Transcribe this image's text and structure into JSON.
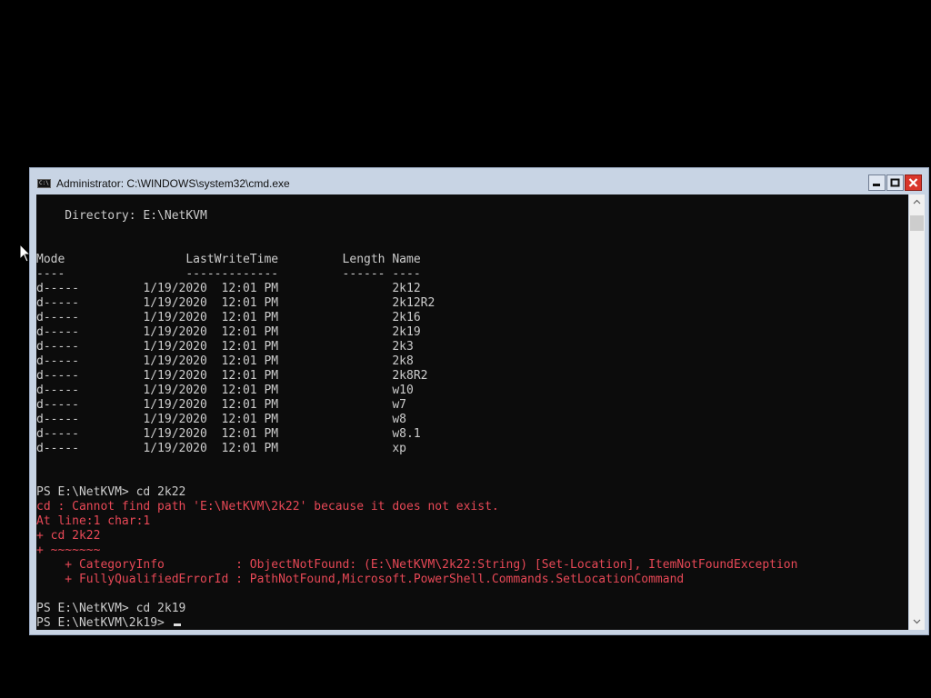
{
  "window": {
    "title": "Administrator: C:\\WINDOWS\\system32\\cmd.exe",
    "icon_text": "C:\\",
    "app_icon": "cmd-icon",
    "controls": [
      "minimize-icon",
      "maximize-icon",
      "close-icon"
    ]
  },
  "colors": {
    "console_bg": "#0c0c0c",
    "console_text": "#cccccc",
    "error_text": "#e74856",
    "titlebar_bg": "#c8d4e4",
    "close_button": "#d9362b"
  },
  "console": {
    "lines": [
      {
        "text": "",
        "type": "normal"
      },
      {
        "text": "    Directory: E:\\NetKVM",
        "type": "normal"
      },
      {
        "text": "",
        "type": "normal"
      },
      {
        "text": "",
        "type": "normal"
      },
      {
        "text": "Mode                 LastWriteTime         Length Name",
        "type": "normal"
      },
      {
        "text": "----                 -------------         ------ ----",
        "type": "normal"
      },
      {
        "text": "d-----         1/19/2020  12:01 PM                2k12",
        "type": "normal"
      },
      {
        "text": "d-----         1/19/2020  12:01 PM                2k12R2",
        "type": "normal"
      },
      {
        "text": "d-----         1/19/2020  12:01 PM                2k16",
        "type": "normal"
      },
      {
        "text": "d-----         1/19/2020  12:01 PM                2k19",
        "type": "normal"
      },
      {
        "text": "d-----         1/19/2020  12:01 PM                2k3",
        "type": "normal"
      },
      {
        "text": "d-----         1/19/2020  12:01 PM                2k8",
        "type": "normal"
      },
      {
        "text": "d-----         1/19/2020  12:01 PM                2k8R2",
        "type": "normal"
      },
      {
        "text": "d-----         1/19/2020  12:01 PM                w10",
        "type": "normal"
      },
      {
        "text": "d-----         1/19/2020  12:01 PM                w7",
        "type": "normal"
      },
      {
        "text": "d-----         1/19/2020  12:01 PM                w8",
        "type": "normal"
      },
      {
        "text": "d-----         1/19/2020  12:01 PM                w8.1",
        "type": "normal"
      },
      {
        "text": "d-----         1/19/2020  12:01 PM                xp",
        "type": "normal"
      },
      {
        "text": "",
        "type": "normal"
      },
      {
        "text": "",
        "type": "normal"
      },
      {
        "text": "PS E:\\NetKVM> cd 2k22",
        "type": "normal"
      },
      {
        "text": "cd : Cannot find path 'E:\\NetKVM\\2k22' because it does not exist.",
        "type": "err"
      },
      {
        "text": "At line:1 char:1",
        "type": "err"
      },
      {
        "text": "+ cd 2k22",
        "type": "err"
      },
      {
        "text": "+ ~~~~~~~",
        "type": "err"
      },
      {
        "text": "    + CategoryInfo          : ObjectNotFound: (E:\\NetKVM\\2k22:String) [Set-Location], ItemNotFoundException",
        "type": "err"
      },
      {
        "text": "    + FullyQualifiedErrorId : PathNotFound,Microsoft.PowerShell.Commands.SetLocationCommand",
        "type": "err"
      },
      {
        "text": "",
        "type": "normal"
      },
      {
        "text": "PS E:\\NetKVM> cd 2k19",
        "type": "normal"
      }
    ],
    "prompt": "PS E:\\NetKVM\\2k19> "
  }
}
